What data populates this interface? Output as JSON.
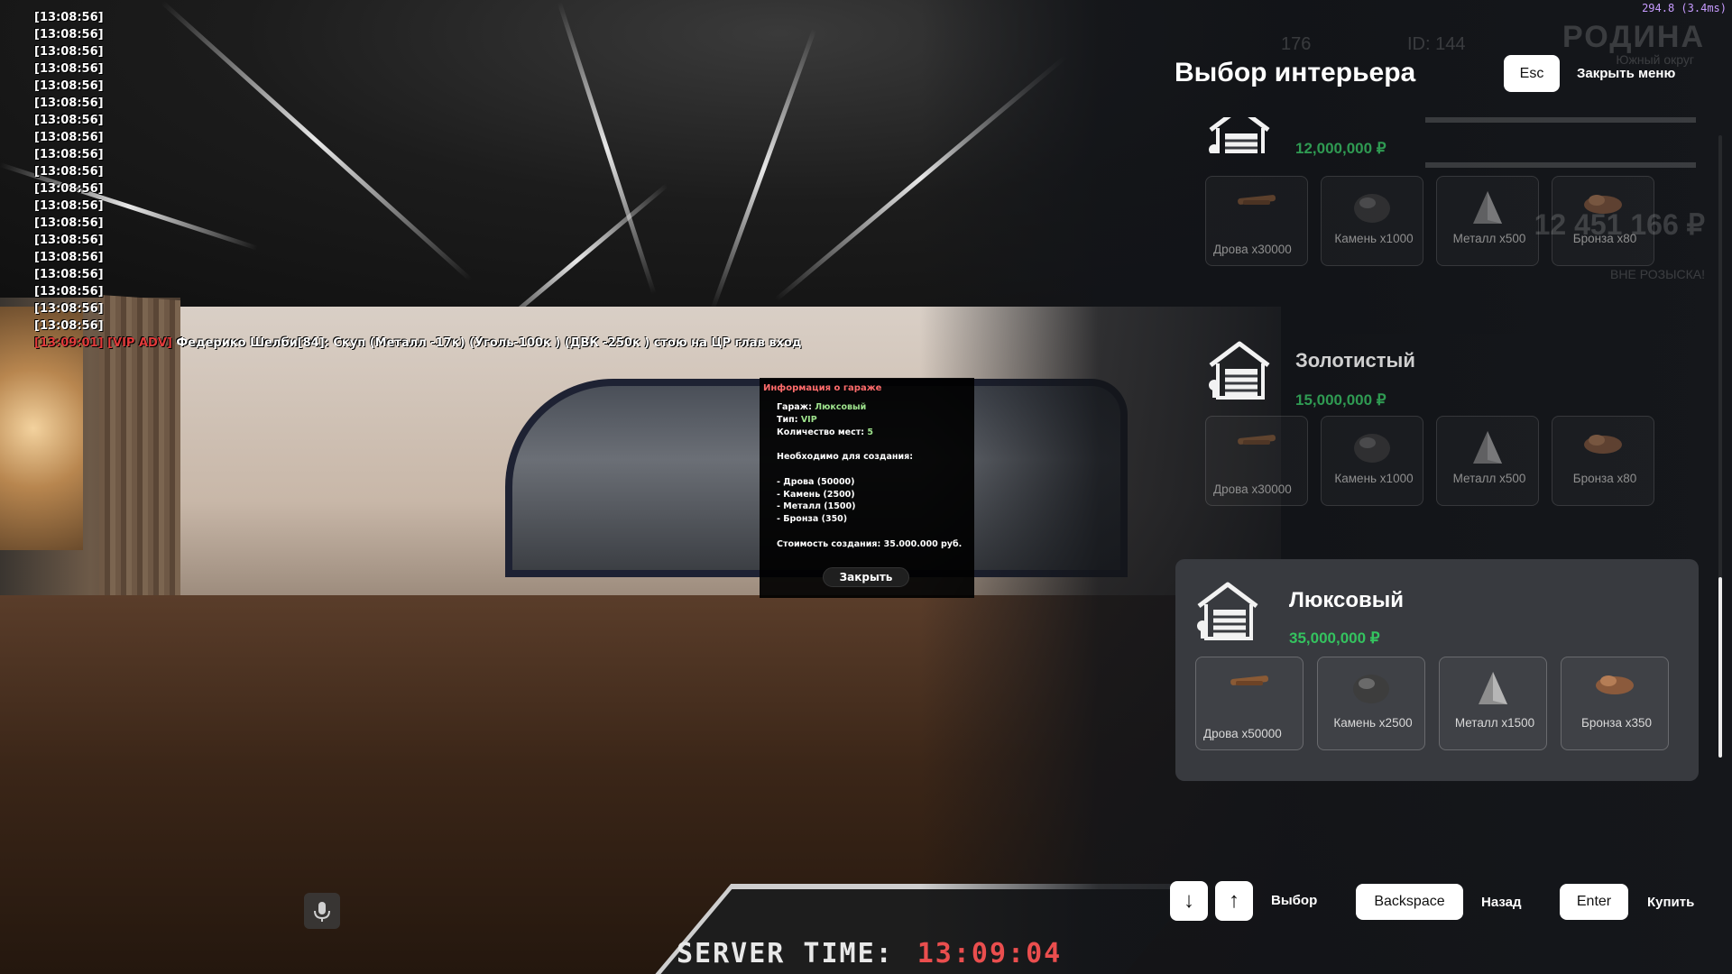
{
  "fps": "294.8 (3.4ms)",
  "chat": {
    "timestamps": [
      "[13:08:56]",
      "[13:08:56]",
      "[13:08:56]",
      "[13:08:56]",
      "[13:08:56]",
      "[13:08:56]",
      "[13:08:56]",
      "[13:08:56]",
      "[13:08:56]",
      "[13:08:56]",
      "[13:08:56]",
      "[13:08:56]",
      "[13:08:56]",
      "[13:08:56]",
      "[13:08:56]",
      "[13:08:56]",
      "[13:08:56]",
      "[13:08:56]",
      "[13:08:56]"
    ],
    "adv_time": "[13:09:01]",
    "adv_tag": "[VIP ADV]",
    "adv_message": "Федерико Шелби[84]: Скуп (Металл -17к) (Уголь-100к ) (ДВК -250к ) стою на ЦР глав вход"
  },
  "hud": {
    "brand": "РОДИНА",
    "brand_sub": "Южный округ",
    "players": "176",
    "player_id": "ID: 144",
    "money": "12 451 166 ₽",
    "wanted": "ВНЕ РОЗЫСКА!"
  },
  "dialog": {
    "title": "Информация о гараже",
    "garage_label": "Гараж:",
    "garage_value": "Люксовый",
    "type_label": "Тип:",
    "type_value": "VIP",
    "seats_label": "Количество мест:",
    "seats_value": "5",
    "required_label": "Необходимо для создания:",
    "req1": "- Дрова (50000)",
    "req2": "- Камень (2500)",
    "req3": "- Металл (1500)",
    "req4": "- Бронза (350)",
    "cost": "Стоимость создания: 35.000.000 руб.",
    "close_button": "Закрыть"
  },
  "menu": {
    "title": "Выбор интерьера",
    "esc_key": "Esc",
    "close_label": "Закрыть меню"
  },
  "interiors": [
    {
      "name": "",
      "price": "12,000,000 ₽",
      "resources": [
        "Дрова x30000",
        "Камень x1000",
        "Металл x500",
        "Бронза x80"
      ]
    },
    {
      "name": "Золотистый",
      "price": "15,000,000 ₽",
      "resources": [
        "Дрова x30000",
        "Камень x1000",
        "Металл x500",
        "Бронза x80"
      ]
    },
    {
      "name": "Люксовый",
      "price": "35,000,000 ₽",
      "resources": [
        "Дрова x50000",
        "Камень x2500",
        "Металл x1500",
        "Бронза x350"
      ]
    }
  ],
  "footer": {
    "down_key": "↓",
    "up_key": "↑",
    "select_label": "Выбор",
    "backspace_key": "Backspace",
    "back_label": "Назад",
    "enter_key": "Enter",
    "buy_label": "Купить"
  },
  "server_time": {
    "label": "SERVER TIME:",
    "value": "13:09:04"
  },
  "colors": {
    "price_green": "#34c35f",
    "adv_red": "#e23b3b",
    "fps_purple": "#c79bff"
  }
}
